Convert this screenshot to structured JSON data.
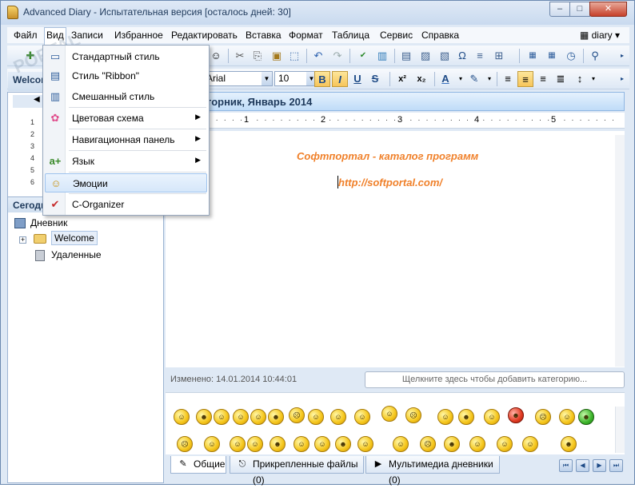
{
  "window": {
    "title": "Advanced Diary - Испытательная версия [осталось дней: 30]",
    "minimize": "–",
    "maximize": "□",
    "close": "✕"
  },
  "menu": {
    "items": [
      "Файл",
      "Вид",
      "Записи",
      "Избранное",
      "Редактировать",
      "Вставка",
      "Формат",
      "Таблица",
      "Сервис",
      "Справка"
    ],
    "diary_selector": "diary"
  },
  "format_toolbar": {
    "font_name": "Arial",
    "font_size": "10",
    "bold": "B",
    "italic": "I",
    "underline": "U",
    "strike": "S",
    "superscript": "x²",
    "subscript": "x₂"
  },
  "left_panel": {
    "header": "Welcome",
    "calendar_rows": [
      "1",
      "2",
      "3",
      "4",
      "5",
      "6"
    ],
    "today_header": "Сегодня",
    "tree": {
      "root": "Дневник",
      "welcome": "Welcome",
      "deleted": "Удаленные"
    }
  },
  "view_menu": {
    "items": [
      {
        "label": "Стандартный стиль",
        "icon": "standard-style-icon",
        "submenu": false
      },
      {
        "label": "Стиль \"Ribbon\"",
        "icon": "ribbon-style-icon",
        "submenu": false
      },
      {
        "label": "Смешанный стиль",
        "icon": "mixed-style-icon",
        "submenu": false
      },
      {
        "label": "Цветовая схема",
        "icon": "color-scheme-icon",
        "submenu": true
      },
      {
        "label": "Навигационная панель",
        "icon": "",
        "submenu": true
      },
      {
        "label": "Язык",
        "icon": "language-icon",
        "submenu": true
      },
      {
        "label": "Эмоции",
        "icon": "smiley-icon",
        "submenu": false,
        "highlighted": true
      },
      {
        "label": "C-Organizer",
        "icon": "c-organizer-icon",
        "submenu": false
      }
    ]
  },
  "editor": {
    "header": "торник, Январь 2014",
    "ruler_numbers": [
      "1",
      "2",
      "3",
      "4",
      "5"
    ],
    "doc_title": "Софтпортал - каталог программ",
    "doc_link": "http://softportal.com/",
    "modified": "Изменено: 14.01.2014 10:44:01",
    "category_placeholder": "Щелкните здесь чтобы добавить категорию..."
  },
  "bottom_tabs": {
    "general": "Общие",
    "attachments": "Прикрепленные файлы (0)",
    "multimedia": "Мультимедиа дневники (0)"
  },
  "colors": {
    "accent": "#f0812b",
    "frame": "#dfe9f5",
    "highlight": "#d6e7fa"
  }
}
